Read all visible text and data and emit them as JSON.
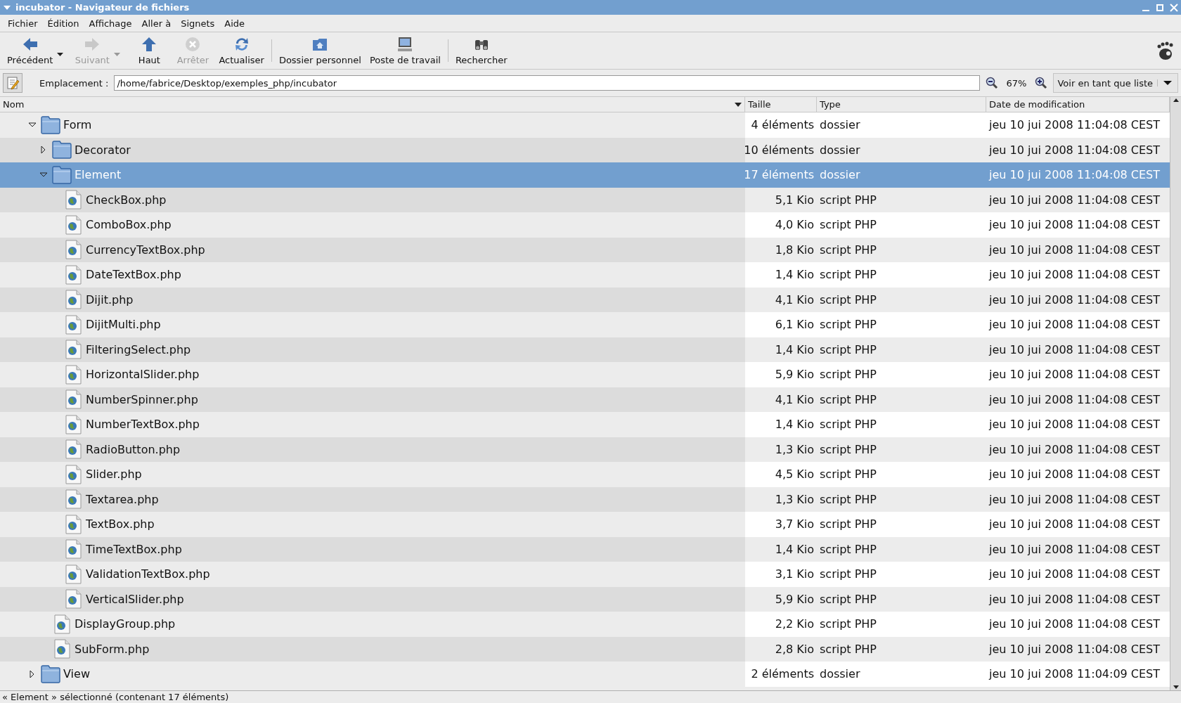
{
  "window": {
    "title": "incubator - Navigateur de fichiers"
  },
  "menu": [
    "Fichier",
    "Édition",
    "Affichage",
    "Aller à",
    "Signets",
    "Aide"
  ],
  "toolbar": {
    "groups": [
      [
        {
          "kind": "back",
          "label": "Précédent",
          "disabled": false,
          "has_menu": true
        },
        {
          "kind": "forward",
          "label": "Suivant",
          "disabled": true,
          "has_menu": true
        },
        {
          "kind": "up",
          "label": "Haut",
          "disabled": false,
          "has_menu": false
        },
        {
          "kind": "stop",
          "label": "Arrêter",
          "disabled": true,
          "has_menu": false
        },
        {
          "kind": "reload",
          "label": "Actualiser",
          "disabled": false,
          "has_menu": false
        }
      ],
      [
        {
          "kind": "home",
          "label": "Dossier personnel",
          "disabled": false,
          "has_menu": false
        },
        {
          "kind": "computer",
          "label": "Poste de travail",
          "disabled": false,
          "has_menu": false
        }
      ],
      [
        {
          "kind": "search",
          "label": "Rechercher",
          "disabled": false,
          "has_menu": false
        }
      ]
    ]
  },
  "location": {
    "label": "Emplacement :",
    "value": "/home/fabrice/Desktop/exemples_php/incubator",
    "zoom": "67%",
    "view": "Voir en tant que liste"
  },
  "columns": [
    {
      "label": "Nom",
      "sorted": true
    },
    {
      "label": "Taille",
      "sorted": false
    },
    {
      "label": "Type",
      "sorted": false
    },
    {
      "label": "Date de modification",
      "sorted": false
    }
  ],
  "tree": [
    {
      "kind": "folder",
      "name": "Form",
      "size": "4 éléments",
      "type": "dossier",
      "date": "jeu 10 jui 2008 11:04:08 CEST",
      "expanded": true,
      "selected": false,
      "children": [
        {
          "kind": "folder",
          "name": "Decorator",
          "size": "10 éléments",
          "type": "dossier",
          "date": "jeu 10 jui 2008 11:04:08 CEST",
          "expanded": false,
          "selected": false
        },
        {
          "kind": "folder",
          "name": "Element",
          "size": "17 éléments",
          "type": "dossier",
          "date": "jeu 10 jui 2008 11:04:08 CEST",
          "expanded": true,
          "selected": true,
          "children": [
            {
              "kind": "file",
              "name": "CheckBox.php",
              "size": "5,1 Kio",
              "type": "script PHP",
              "date": "jeu 10 jui 2008 11:04:08 CEST",
              "selected": false
            },
            {
              "kind": "file",
              "name": "ComboBox.php",
              "size": "4,0 Kio",
              "type": "script PHP",
              "date": "jeu 10 jui 2008 11:04:08 CEST",
              "selected": false
            },
            {
              "kind": "file",
              "name": "CurrencyTextBox.php",
              "size": "1,8 Kio",
              "type": "script PHP",
              "date": "jeu 10 jui 2008 11:04:08 CEST",
              "selected": false
            },
            {
              "kind": "file",
              "name": "DateTextBox.php",
              "size": "1,4 Kio",
              "type": "script PHP",
              "date": "jeu 10 jui 2008 11:04:08 CEST",
              "selected": false
            },
            {
              "kind": "file",
              "name": "Dijit.php",
              "size": "4,1 Kio",
              "type": "script PHP",
              "date": "jeu 10 jui 2008 11:04:08 CEST",
              "selected": false
            },
            {
              "kind": "file",
              "name": "DijitMulti.php",
              "size": "6,1 Kio",
              "type": "script PHP",
              "date": "jeu 10 jui 2008 11:04:08 CEST",
              "selected": false
            },
            {
              "kind": "file",
              "name": "FilteringSelect.php",
              "size": "1,4 Kio",
              "type": "script PHP",
              "date": "jeu 10 jui 2008 11:04:08 CEST",
              "selected": false
            },
            {
              "kind": "file",
              "name": "HorizontalSlider.php",
              "size": "5,9 Kio",
              "type": "script PHP",
              "date": "jeu 10 jui 2008 11:04:08 CEST",
              "selected": false
            },
            {
              "kind": "file",
              "name": "NumberSpinner.php",
              "size": "4,1 Kio",
              "type": "script PHP",
              "date": "jeu 10 jui 2008 11:04:08 CEST",
              "selected": false
            },
            {
              "kind": "file",
              "name": "NumberTextBox.php",
              "size": "1,4 Kio",
              "type": "script PHP",
              "date": "jeu 10 jui 2008 11:04:08 CEST",
              "selected": false
            },
            {
              "kind": "file",
              "name": "RadioButton.php",
              "size": "1,3 Kio",
              "type": "script PHP",
              "date": "jeu 10 jui 2008 11:04:08 CEST",
              "selected": false
            },
            {
              "kind": "file",
              "name": "Slider.php",
              "size": "4,5 Kio",
              "type": "script PHP",
              "date": "jeu 10 jui 2008 11:04:08 CEST",
              "selected": false
            },
            {
              "kind": "file",
              "name": "Textarea.php",
              "size": "1,3 Kio",
              "type": "script PHP",
              "date": "jeu 10 jui 2008 11:04:08 CEST",
              "selected": false
            },
            {
              "kind": "file",
              "name": "TextBox.php",
              "size": "3,7 Kio",
              "type": "script PHP",
              "date": "jeu 10 jui 2008 11:04:08 CEST",
              "selected": false
            },
            {
              "kind": "file",
              "name": "TimeTextBox.php",
              "size": "1,4 Kio",
              "type": "script PHP",
              "date": "jeu 10 jui 2008 11:04:08 CEST",
              "selected": false
            },
            {
              "kind": "file",
              "name": "ValidationTextBox.php",
              "size": "3,1 Kio",
              "type": "script PHP",
              "date": "jeu 10 jui 2008 11:04:08 CEST",
              "selected": false
            },
            {
              "kind": "file",
              "name": "VerticalSlider.php",
              "size": "5,9 Kio",
              "type": "script PHP",
              "date": "jeu 10 jui 2008 11:04:08 CEST",
              "selected": false
            }
          ]
        },
        {
          "kind": "file",
          "name": "DisplayGroup.php",
          "size": "2,2 Kio",
          "type": "script PHP",
          "date": "jeu 10 jui 2008 11:04:08 CEST",
          "selected": false
        },
        {
          "kind": "file",
          "name": "SubForm.php",
          "size": "2,8 Kio",
          "type": "script PHP",
          "date": "jeu 10 jui 2008 11:04:08 CEST",
          "selected": false
        }
      ]
    },
    {
      "kind": "folder",
      "name": "View",
      "size": "2 éléments",
      "type": "dossier",
      "date": "jeu 10 jui 2008 11:04:09 CEST",
      "expanded": false,
      "selected": false
    }
  ],
  "status_bar": "« Element » sélectionné (contenant 17 éléments)"
}
